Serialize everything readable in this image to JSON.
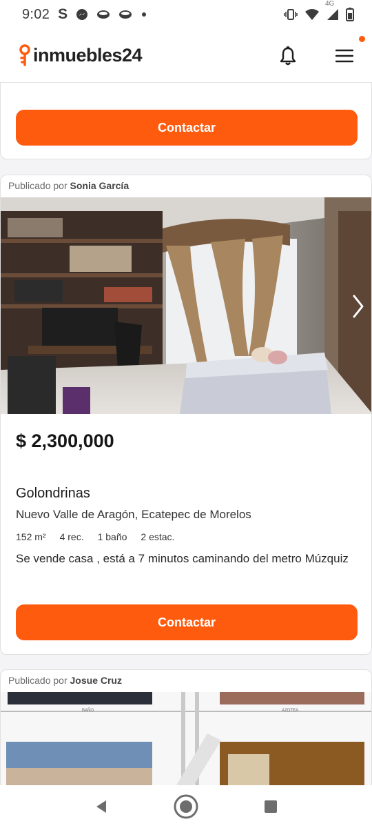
{
  "status_bar": {
    "time": "9:02",
    "s_label": "S",
    "network_label": "4G",
    "left_icons": [
      "s-letter-icon",
      "messenger-icon",
      "cup-icon",
      "cup-icon",
      "dot-icon"
    ],
    "right_icons": [
      "vibrate-icon",
      "wifi-icon",
      "signal-icon",
      "battery-icon"
    ]
  },
  "header": {
    "logo_text": "inmuebles24",
    "brand_color": "#ff5b0f"
  },
  "cards": [
    {
      "button_label": "Contactar"
    },
    {
      "published_prefix": "Publicado por",
      "publisher": "Sonia García",
      "price": "$ 2,300,000",
      "title": "Golondrinas",
      "location": "Nuevo Valle de Aragón, Ecatepec de Morelos",
      "features": [
        "152 m²",
        "4 rec.",
        "1 baño",
        "2 estac."
      ],
      "description": "Se vende casa , está a 7 minutos caminando del metro Múzquiz",
      "button_label": "Contactar"
    },
    {
      "published_prefix": "Publicado por",
      "publisher": "Josue Cruz",
      "plan_labels": [
        "BAÑO",
        "AZOTEA"
      ]
    }
  ],
  "nav": {
    "icons": [
      "back-icon",
      "home-icon",
      "recents-icon"
    ]
  }
}
